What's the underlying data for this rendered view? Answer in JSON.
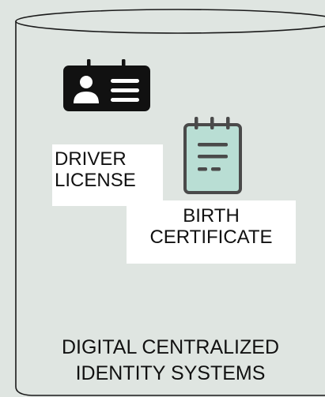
{
  "colors": {
    "background": "#dfe5e1",
    "cylinder_stroke": "#1a1a1a",
    "id_card_fill": "#111111",
    "notepad_fill": "#b9ded4",
    "notepad_stroke": "#4a4a4a",
    "label_background": "#ffffff"
  },
  "icons": {
    "id_card": "id-card-icon",
    "notepad": "notepad-icon"
  },
  "driver_license": {
    "line1": "DRIVER",
    "line2": "LICENSE"
  },
  "birth_certificate": {
    "line1": "BIRTH",
    "line2": "CERTIFICATE"
  },
  "system": {
    "line1": "DIGITAL CENTRALIZED",
    "line2": "IDENTITY SYSTEMS"
  }
}
